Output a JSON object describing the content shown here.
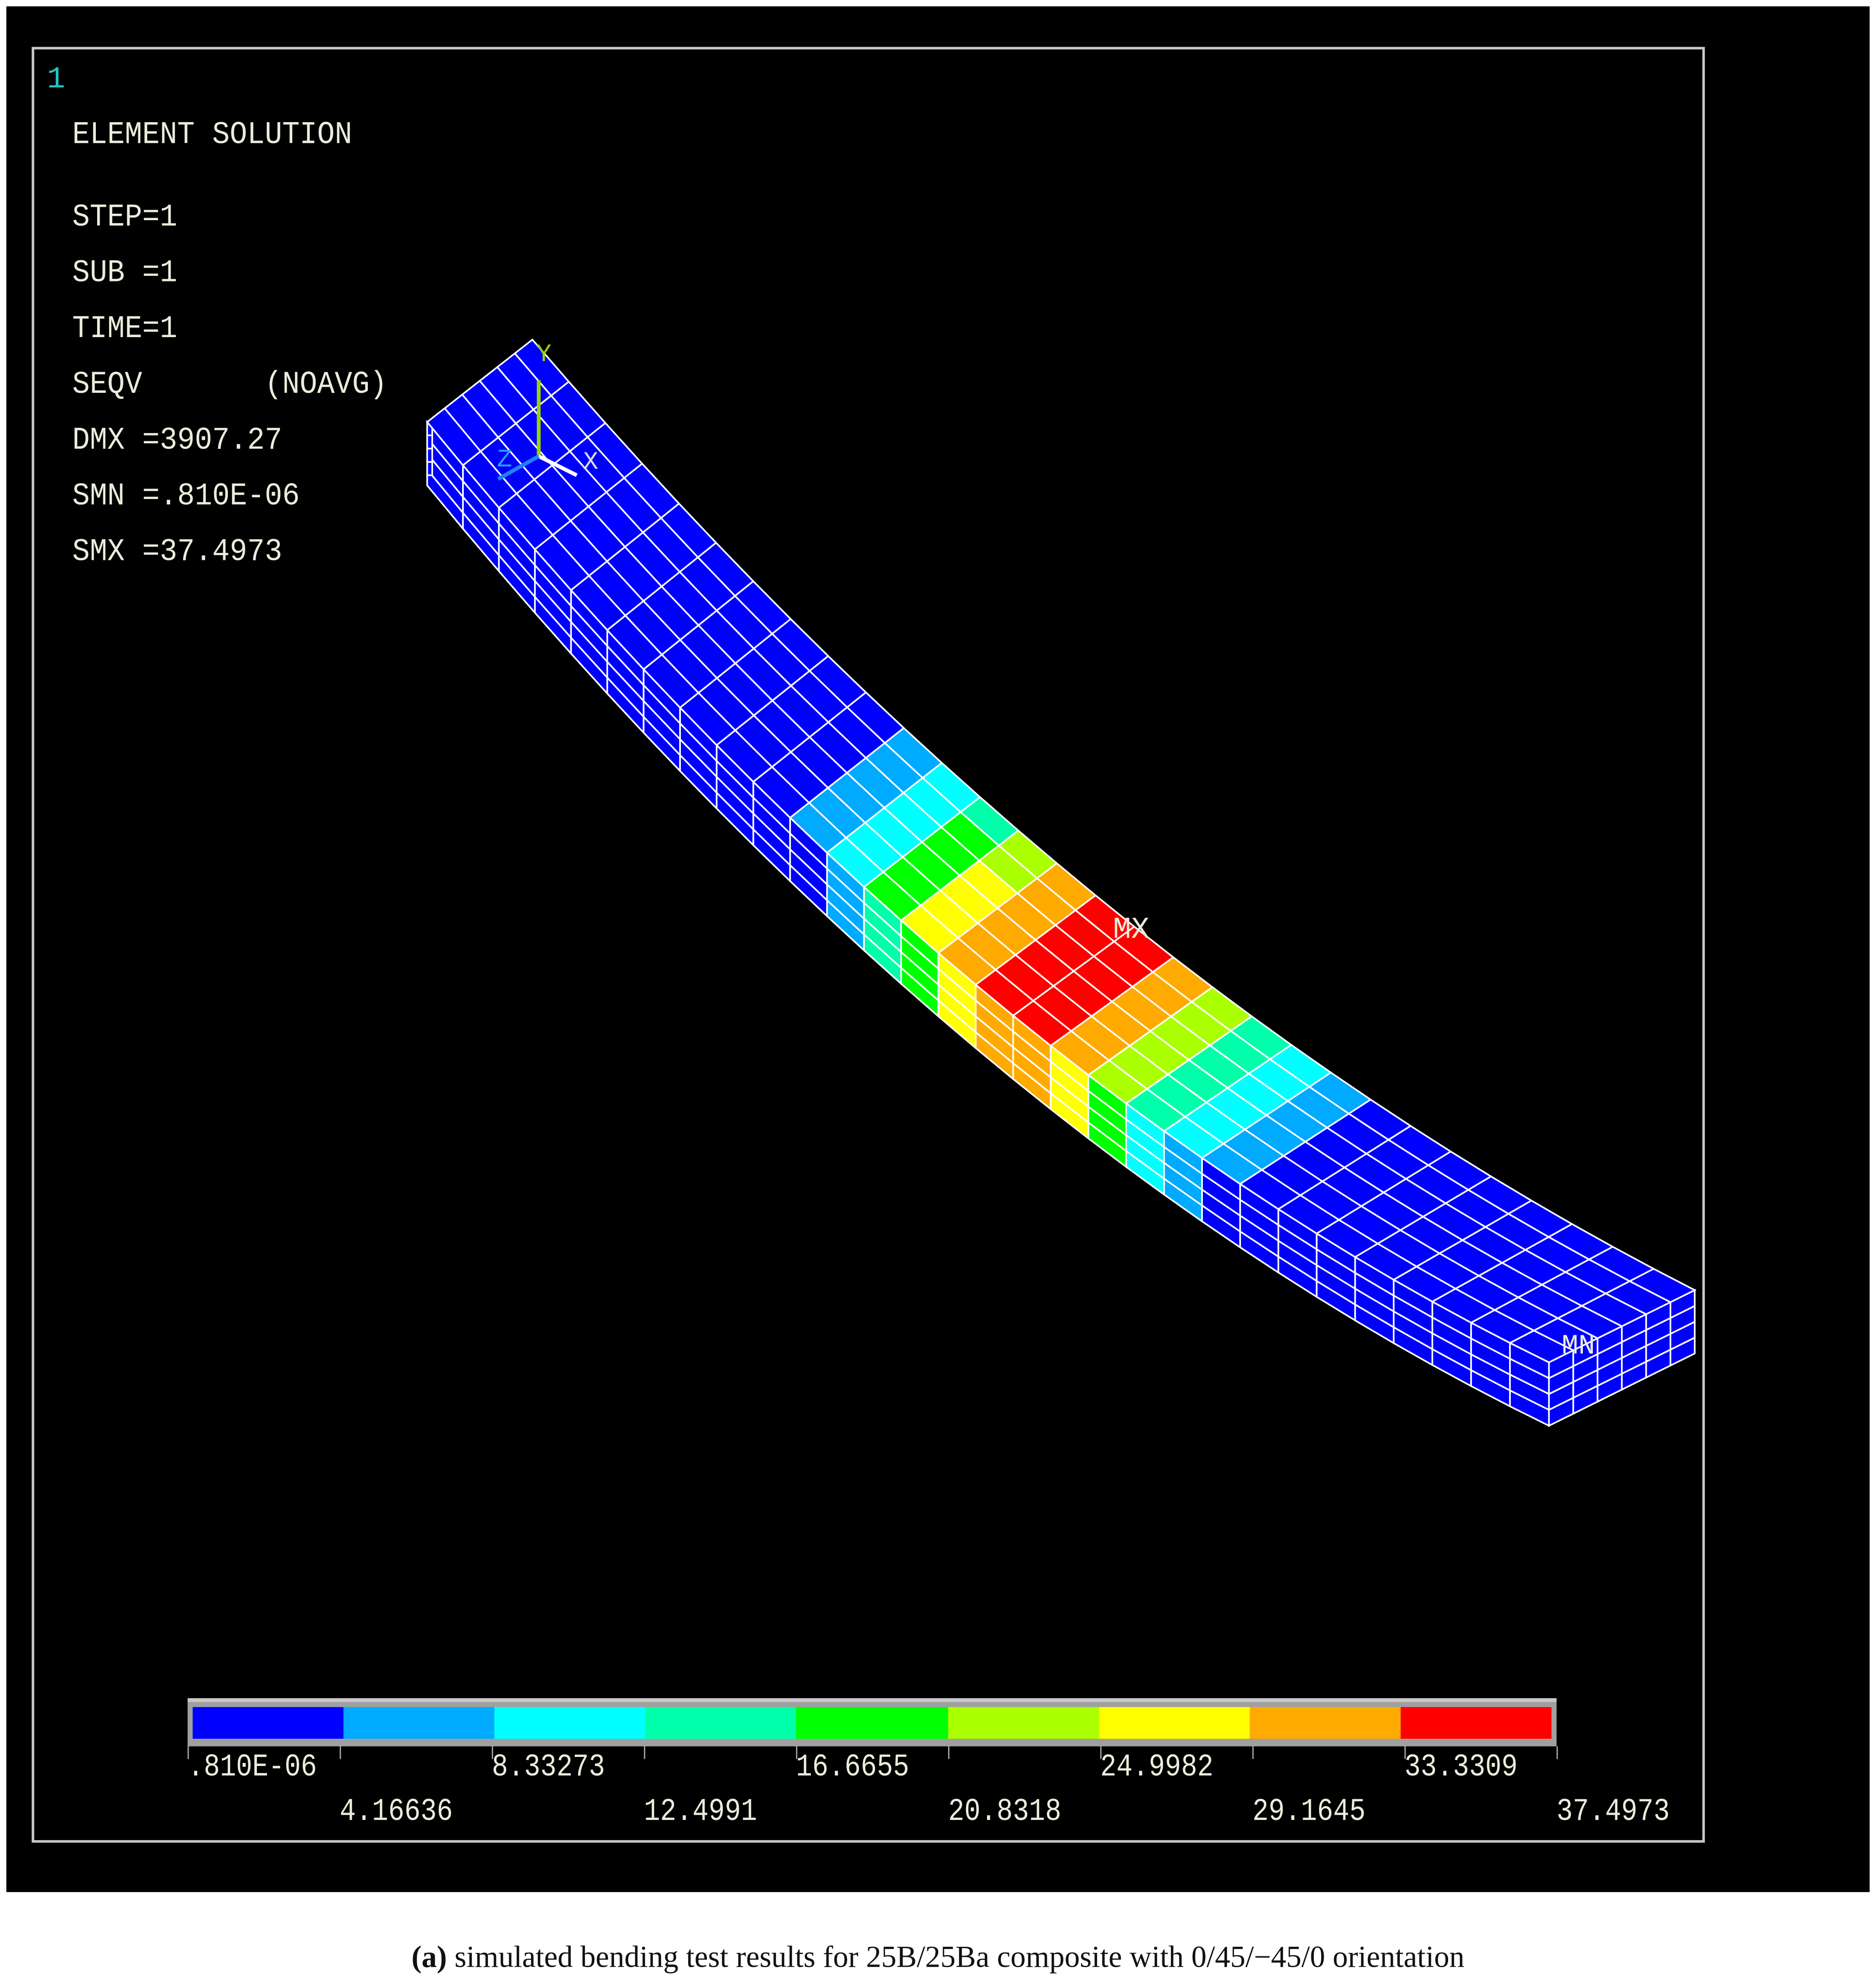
{
  "window_number": "1",
  "info": {
    "title": "ELEMENT SOLUTION",
    "lines": [
      "STEP=1",
      "SUB =1",
      "TIME=1",
      "SEQV       (NOAVG)",
      "DMX =3907.27",
      "SMN =.810E-06",
      "SMX =37.4973"
    ]
  },
  "triad": {
    "y_label": "Y",
    "x_label": "X",
    "z_label": "Z"
  },
  "markers": {
    "max_label": "MX",
    "min_label": "MN"
  },
  "legend": {
    "colors": [
      "#0000ff",
      "#00aaff",
      "#00ffff",
      "#00ffaa",
      "#00ff00",
      "#aaff00",
      "#ffff00",
      "#ffaa00",
      "#ff0000"
    ],
    "labels": [
      ".810E-06",
      "4.16636",
      "8.33273",
      "12.4991",
      "16.6655",
      "20.8318",
      "24.9982",
      "29.1645",
      "33.3309",
      "37.4973"
    ]
  },
  "caption": {
    "prefix": "(a)",
    "text": " simulated bending test results for 25B/25Ba composite with 0/45/−45/0 orientation"
  }
}
